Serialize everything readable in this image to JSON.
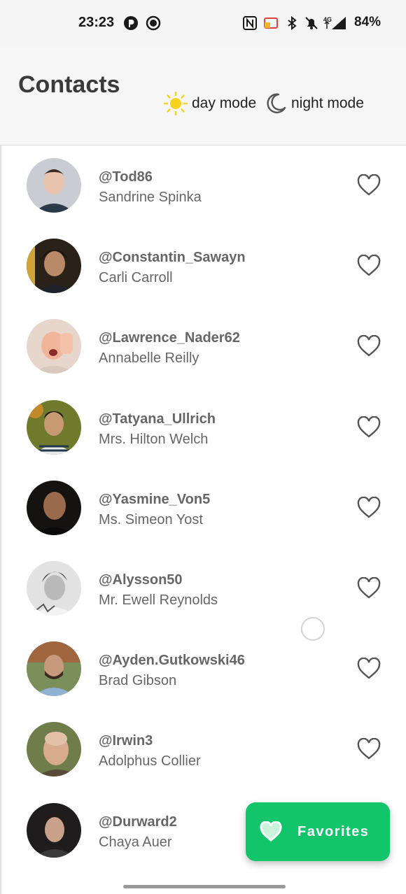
{
  "status_bar": {
    "time": "23:23",
    "battery": "84%",
    "network": "4G"
  },
  "header": {
    "title": "Contacts",
    "day_mode_label": "day mode",
    "night_mode_label": "night mode"
  },
  "colors": {
    "accent": "#12c56b",
    "sun": "#f5d31c",
    "text_secondary": "#666666"
  },
  "contacts": [
    {
      "handle": "@Tod86",
      "name": "Sandrine Spinka"
    },
    {
      "handle": "@Constantin_Sawayn",
      "name": "Carli Carroll"
    },
    {
      "handle": "@Lawrence_Nader62",
      "name": "Annabelle Reilly"
    },
    {
      "handle": "@Tatyana_Ullrich",
      "name": "Mrs. Hilton Welch"
    },
    {
      "handle": "@Yasmine_Von5",
      "name": "Ms. Simeon Yost"
    },
    {
      "handle": "@Alysson50",
      "name": "Mr. Ewell Reynolds"
    },
    {
      "handle": "@Ayden.Gutkowski46",
      "name": "Brad Gibson"
    },
    {
      "handle": "@Irwin3",
      "name": "Adolphus Collier"
    },
    {
      "handle": "@Durward2",
      "name": "Chaya Auer"
    }
  ],
  "fab": {
    "label": "Favorites"
  },
  "icons": {
    "heart": "heart-outline-icon",
    "sun": "sun-icon",
    "moon": "moon-icon"
  }
}
